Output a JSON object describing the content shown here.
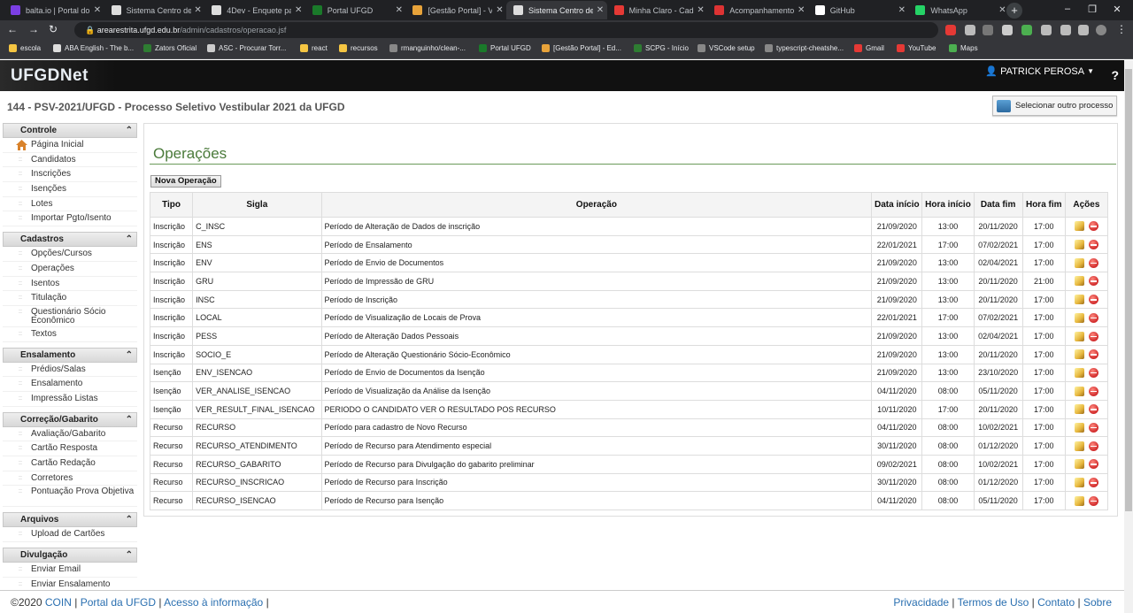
{
  "browser": {
    "tabs": [
      {
        "title": "balta.io | Portal do ...",
        "color": "#7b3fe4"
      },
      {
        "title": "Sistema Centro de ...",
        "color": "#dddddd"
      },
      {
        "title": "4Dev - Enquete pa...",
        "color": "#dddddd"
      },
      {
        "title": "Portal UFGD",
        "color": "#1a7a2a"
      },
      {
        "title": "[Gestão Portal] - Vi...",
        "color": "#e8a33a"
      },
      {
        "title": "Sistema Centro de ...",
        "color": "#dddddd"
      },
      {
        "title": "Minha Claro - Cad...",
        "color": "#e53935"
      },
      {
        "title": "Acompanhamento ...",
        "color": "#d33"
      },
      {
        "title": "GitHub",
        "color": "#ffffff"
      },
      {
        "title": "WhatsApp",
        "color": "#25d366"
      }
    ],
    "new_tab": "+",
    "window_controls": [
      "–",
      "❐",
      "✕"
    ],
    "url_host": "arearestrita.ufgd.edu.br",
    "url_path": "/admin/cadastros/operacao.jsf",
    "bookmarks": [
      {
        "label": "escola",
        "color": "#f5c542"
      },
      {
        "label": "ABA English - The b...",
        "color": "#dddddd"
      },
      {
        "label": "Zators Oficial",
        "color": "#2e7d32"
      },
      {
        "label": "ASC - Procurar Torr...",
        "color": "#cccccc"
      },
      {
        "label": "react",
        "color": "#f5c542"
      },
      {
        "label": "recursos",
        "color": "#f5c542"
      },
      {
        "label": "rmanguinho/clean-...",
        "color": "#888888"
      },
      {
        "label": "Portal UFGD",
        "color": "#1a7a2a"
      },
      {
        "label": "[Gestão Portal] - Ed...",
        "color": "#e8a33a"
      },
      {
        "label": "SCPG - Início",
        "color": "#2e7d32"
      },
      {
        "label": "VSCode setup",
        "color": "#888888"
      },
      {
        "label": "typescript-cheatshe...",
        "color": "#888888"
      },
      {
        "label": "Gmail",
        "color": "#e53935"
      },
      {
        "label": "YouTube",
        "color": "#e53935"
      },
      {
        "label": "Maps",
        "color": "#4caf50"
      }
    ]
  },
  "header": {
    "logo": "UFGDNet",
    "user": "PATRICK PEROSA",
    "help": "?"
  },
  "process_title": "144 - PSV-2021/UFGD - Processo Seletivo Vestibular 2021 da UFGD",
  "select_process": "Selecionar outro processo",
  "sidebar": [
    {
      "title": "Controle",
      "items": [
        "Página Inicial",
        "Candidatos",
        "Inscrições",
        "Isenções",
        "Lotes",
        "Importar Pgto/Isento"
      ]
    },
    {
      "title": "Cadastros",
      "items": [
        "Opções/Cursos",
        "Operações",
        "Isentos",
        "Titulação",
        "Questionário Sócio Econômico",
        "Textos"
      ]
    },
    {
      "title": "Ensalamento",
      "items": [
        "Prédios/Salas",
        "Ensalamento",
        "Impressão Listas"
      ]
    },
    {
      "title": "Correção/Gabarito",
      "items": [
        "Avaliação/Gabarito",
        "Cartão Resposta",
        "Cartão Redação",
        "Corretores",
        "Pontuação Prova Objetiva"
      ]
    },
    {
      "title": "Arquivos",
      "items": [
        "Upload de Cartões"
      ]
    },
    {
      "title": "Divulgação",
      "items": [
        "Enviar Email",
        "Enviar Ensalamento"
      ]
    }
  ],
  "main": {
    "title": "Operações",
    "new_button": "Nova Operação",
    "columns": [
      "Tipo",
      "Sigla",
      "Operação",
      "Data início",
      "Hora início",
      "Data fim",
      "Hora fim",
      "Ações"
    ],
    "rows": [
      [
        "Inscrição",
        "C_INSC",
        "Período de Alteração de Dados de inscrição",
        "21/09/2020",
        "13:00",
        "20/11/2020",
        "17:00"
      ],
      [
        "Inscrição",
        "ENS",
        "Período de Ensalamento",
        "22/01/2021",
        "17:00",
        "07/02/2021",
        "17:00"
      ],
      [
        "Inscrição",
        "ENV",
        "Período de Envio de Documentos",
        "21/09/2020",
        "13:00",
        "02/04/2021",
        "17:00"
      ],
      [
        "Inscrição",
        "GRU",
        "Período de Impressão de GRU",
        "21/09/2020",
        "13:00",
        "20/11/2020",
        "21:00"
      ],
      [
        "Inscrição",
        "INSC",
        "Período de Inscrição",
        "21/09/2020",
        "13:00",
        "20/11/2020",
        "17:00"
      ],
      [
        "Inscrição",
        "LOCAL",
        "Período de Visualização de Locais de Prova",
        "22/01/2021",
        "17:00",
        "07/02/2021",
        "17:00"
      ],
      [
        "Inscrição",
        "PESS",
        "Período de Alteração Dados Pessoais",
        "21/09/2020",
        "13:00",
        "02/04/2021",
        "17:00"
      ],
      [
        "Inscrição",
        "SOCIO_E",
        "Período de Alteração Questionário Sócio-Econômico",
        "21/09/2020",
        "13:00",
        "20/11/2020",
        "17:00"
      ],
      [
        "Isenção",
        "ENV_ISENCAO",
        "Período de Envio de Documentos da Isenção",
        "21/09/2020",
        "13:00",
        "23/10/2020",
        "17:00"
      ],
      [
        "Isenção",
        "VER_ANALISE_ISENCAO",
        "Período de Visualização da Análise da Isenção",
        "04/11/2020",
        "08:00",
        "05/11/2020",
        "17:00"
      ],
      [
        "Isenção",
        "VER_RESULT_FINAL_ISENCAO",
        "PERIODO O CANDIDATO VER O RESULTADO POS RECURSO",
        "10/11/2020",
        "17:00",
        "20/11/2020",
        "17:00"
      ],
      [
        "Recurso",
        "RECURSO",
        "Período para cadastro de Novo Recurso",
        "04/11/2020",
        "08:00",
        "10/02/2021",
        "17:00"
      ],
      [
        "Recurso",
        "RECURSO_ATENDIMENTO",
        "Período de Recurso para Atendimento especial",
        "30/11/2020",
        "08:00",
        "01/12/2020",
        "17:00"
      ],
      [
        "Recurso",
        "RECURSO_GABARITO",
        "Período de Recurso para Divulgação do gabarito preliminar",
        "09/02/2021",
        "08:00",
        "10/02/2021",
        "17:00"
      ],
      [
        "Recurso",
        "RECURSO_INSCRICAO",
        "Período de Recurso para Inscrição",
        "30/11/2020",
        "08:00",
        "01/12/2020",
        "17:00"
      ],
      [
        "Recurso",
        "RECURSO_ISENCAO",
        "Período de Recurso para Isenção",
        "04/11/2020",
        "08:00",
        "05/11/2020",
        "17:00"
      ]
    ]
  },
  "footer": {
    "copyright": "©2020",
    "left_links": [
      "COIN",
      "Portal da UFGD",
      "Acesso à informação"
    ],
    "right_links": [
      "Privacidade",
      "Termos de Uso",
      "Contato",
      "Sobre"
    ]
  }
}
